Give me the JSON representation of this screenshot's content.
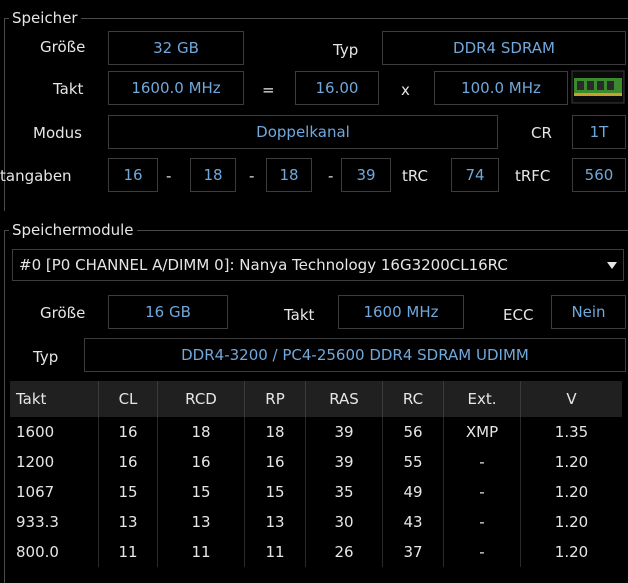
{
  "speicher": {
    "title": "Speicher",
    "groesse_label": "Größe",
    "groesse_value": "32 GB",
    "typ_label": "Typ",
    "typ_value": "DDR4 SDRAM",
    "takt_label": "Takt",
    "takt_value": "1600.0 MHz",
    "eq": "=",
    "multiplier": "16.00",
    "x": "x",
    "base_clock": "100.0 MHz",
    "modus_label": "Modus",
    "modus_value": "Doppelkanal",
    "cr_label": "CR",
    "cr_value": "1T",
    "timings_label": "tangaben",
    "t1": "16",
    "t2": "18",
    "t3": "18",
    "t4": "39",
    "dash": "-",
    "trc_label": "tRC",
    "trc_value": "74",
    "trfc_label": "tRFC",
    "trfc_value": "560"
  },
  "module": {
    "title": "Speichermodule",
    "selected": "#0 [P0 CHANNEL A/DIMM 0]: Nanya Technology 16G3200CL16RC",
    "groesse_label": "Größe",
    "groesse_value": "16 GB",
    "takt_label": "Takt",
    "takt_value": "1600 MHz",
    "ecc_label": "ECC",
    "ecc_value": "Nein",
    "typ_label": "Typ",
    "typ_value": "DDR4-3200 / PC4-25600 DDR4 SDRAM UDIMM"
  },
  "table": {
    "headers": [
      "Takt",
      "CL",
      "RCD",
      "RP",
      "RAS",
      "RC",
      "Ext.",
      "V"
    ],
    "rows": [
      [
        "1600",
        "16",
        "18",
        "18",
        "39",
        "56",
        "XMP",
        "1.35"
      ],
      [
        "1200",
        "16",
        "16",
        "16",
        "39",
        "55",
        "-",
        "1.20"
      ],
      [
        "1067",
        "15",
        "15",
        "15",
        "35",
        "49",
        "-",
        "1.20"
      ],
      [
        "933.3",
        "13",
        "13",
        "13",
        "30",
        "43",
        "-",
        "1.20"
      ],
      [
        "800.0",
        "11",
        "11",
        "11",
        "26",
        "37",
        "-",
        "1.20"
      ]
    ]
  },
  "colors": {
    "value_text": "#6fa8dc",
    "border": "#3c3c3c",
    "header_bg": "#202020"
  }
}
